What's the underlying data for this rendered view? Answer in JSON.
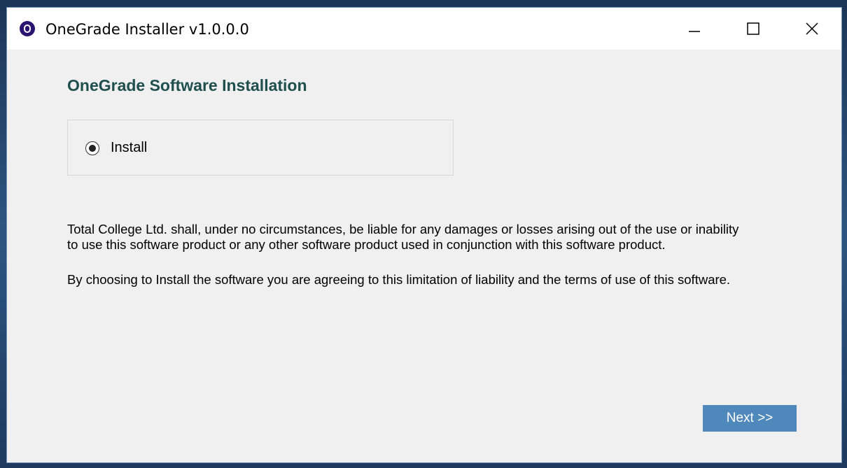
{
  "window": {
    "title": "OneGrade Installer v1.0.0.0",
    "app_icon": "onegrade-logo-icon",
    "controls": [
      "minimize-icon",
      "maximize-icon",
      "close-icon"
    ]
  },
  "main": {
    "heading": "OneGrade Software Installation",
    "option": {
      "label": "Install",
      "selected": true
    },
    "disclaimer_line1": "Total College Ltd. shall, under no circumstances, be liable for any damages or losses arising out of the use or inability",
    "disclaimer_line2": "to use this software product or any other software product used in conjunction with this software product.",
    "agreement": "By choosing to Install the software you are agreeing to this limitation of liability and the terms of use of this software.",
    "next_label": "Next >>"
  },
  "colors": {
    "heading": "#1f4e4e",
    "next_button": "#4f88ba",
    "app_icon": "#2a1470"
  }
}
